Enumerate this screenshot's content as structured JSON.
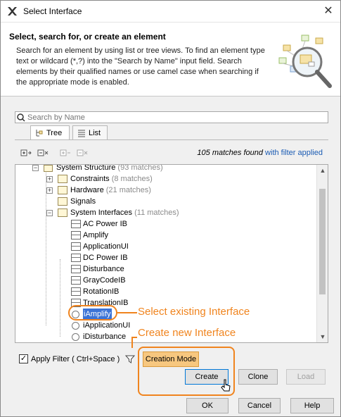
{
  "window": {
    "title": "Select Interface",
    "close_glyph": "✕"
  },
  "header": {
    "title": "Select, search for, or create an element",
    "description": "Search for an element by using list or tree views. To find an element type text or wildcard (*,?) into the \"Search by Name\" input field. Search elements by their qualified names or use camel case when searching if the appropriate mode is enabled."
  },
  "search": {
    "placeholder": "Search by Name",
    "value": ""
  },
  "tabs": {
    "tree": "Tree",
    "list": "List"
  },
  "toolbar": {
    "matches_count": "105 matches found",
    "matches_filter": " with filter applied"
  },
  "tree": {
    "root": {
      "label": "System Structure",
      "count": "(93 matches)"
    },
    "items": [
      {
        "label": "Constraints",
        "count": "(8 matches)",
        "kind": "folder",
        "expandable": true
      },
      {
        "label": "Hardware",
        "count": "(21 matches)",
        "kind": "folder",
        "expandable": true
      },
      {
        "label": "Signals",
        "count": "",
        "kind": "folder",
        "expandable": false
      },
      {
        "label": "System Interfaces",
        "count": "(11 matches)",
        "kind": "folder",
        "expandable": true
      },
      {
        "label": "AC Power IB",
        "kind": "block"
      },
      {
        "label": "Amplify",
        "kind": "block"
      },
      {
        "label": "ApplicationUI",
        "kind": "block"
      },
      {
        "label": "DC Power IB",
        "kind": "block"
      },
      {
        "label": "Disturbance",
        "kind": "block"
      },
      {
        "label": "GrayCodeIB",
        "kind": "block"
      },
      {
        "label": "RotationIB",
        "kind": "block"
      },
      {
        "label": "TranslationIB",
        "kind": "block"
      },
      {
        "label": "iAmplify",
        "kind": "interface",
        "selected": true
      },
      {
        "label": "iApplicationUI",
        "kind": "interface"
      },
      {
        "label": "iDisturbance",
        "kind": "interface"
      }
    ]
  },
  "callouts": {
    "existing": "Select existing Interface",
    "create": "Create new Interface"
  },
  "bottom": {
    "apply_filter": "Apply Filter ( Ctrl+Space )",
    "apply_filter_checked": "✓",
    "creation_mode": "Creation Mode",
    "create": "Create",
    "clone": "Clone",
    "load": "Load"
  },
  "footer": {
    "ok": "OK",
    "cancel": "Cancel",
    "help": "Help"
  },
  "colors": {
    "accent": "#f0841e",
    "selection": "#3b73d6",
    "link": "#1a5bb3"
  }
}
